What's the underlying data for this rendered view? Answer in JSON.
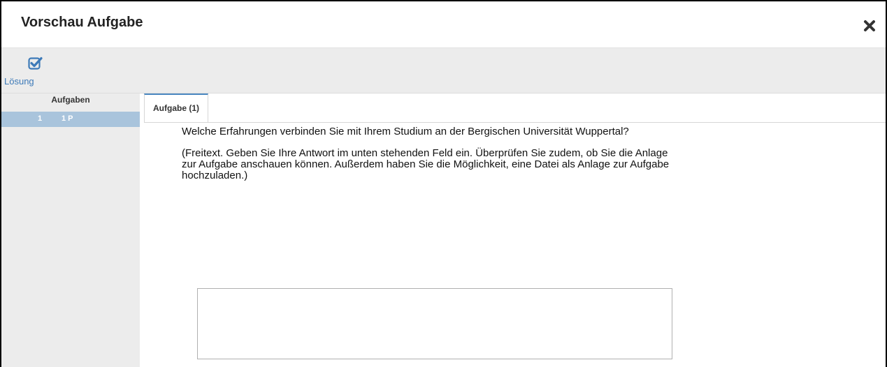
{
  "dialog": {
    "title": "Vorschau Aufgabe",
    "close_icon": "close-icon"
  },
  "toolbar": {
    "solution_label": "Lösung",
    "solution_icon": "checkbox-check-icon"
  },
  "sidebar": {
    "header": "Aufgaben",
    "items": [
      {
        "number": "1",
        "points": "1 P"
      }
    ]
  },
  "tabs": [
    {
      "label": "Aufgabe (1)",
      "active": true
    }
  ],
  "question": {
    "prompt": "Welche Erfahrungen verbinden Sie mit Ihrem Studium an der Bergischen Universität Wuppertal?",
    "instructions": "(Freitext. Geben Sie Ihre Antwort im unten stehenden Feld ein. Überprüfen Sie zudem, ob Sie die Anlage zur Aufgabe anschauen können. Außerdem haben Sie die Möglichkeit, eine Datei als Anlage zur Aufgabe hochzuladen.)"
  },
  "answer": {
    "value": ""
  },
  "colors": {
    "accent": "#3d7ab8",
    "sidebar_selected": "#a9c4dc",
    "toolbar_bg": "#ececec"
  }
}
